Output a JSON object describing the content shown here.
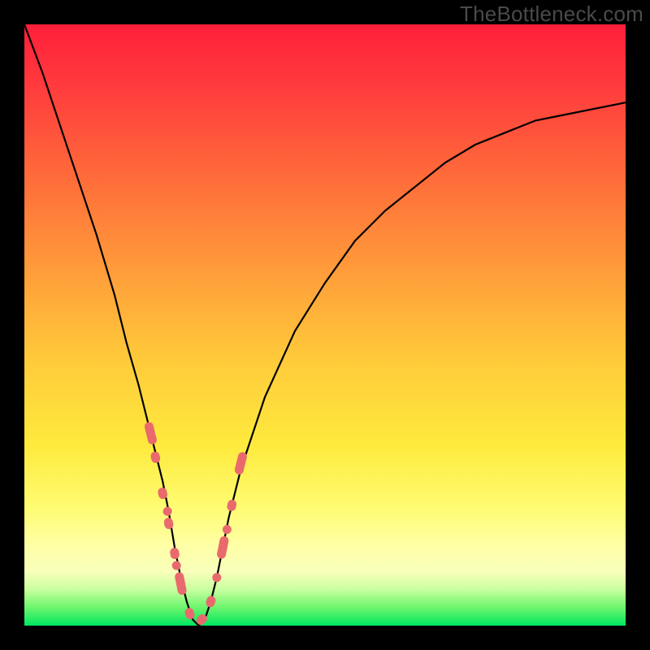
{
  "watermark": "TheBottleneck.com",
  "colors": {
    "background": "#000000",
    "gradient_top": "#ff1f3a",
    "gradient_bottom": "#00e862",
    "curve_stroke": "#000000",
    "marker_fill": "#e96a6d"
  },
  "chart_data": {
    "type": "line",
    "title": "",
    "xlabel": "",
    "ylabel": "",
    "xlim": [
      0,
      100
    ],
    "ylim": [
      0,
      100
    ],
    "grid": false,
    "legend": false,
    "series": [
      {
        "name": "bottleneck-curve",
        "x": [
          0,
          3,
          6,
          9,
          12,
          15,
          17,
          19,
          21,
          22,
          23,
          24,
          25,
          26,
          27,
          28,
          29,
          30,
          31,
          32,
          33,
          34,
          36,
          40,
          45,
          50,
          55,
          60,
          65,
          70,
          75,
          80,
          85,
          90,
          95,
          100
        ],
        "y": [
          100,
          92,
          83,
          74,
          65,
          55,
          47,
          40,
          32,
          28,
          24,
          19,
          13,
          8,
          4,
          1,
          0,
          1,
          4,
          8,
          13,
          18,
          26,
          38,
          49,
          57,
          64,
          69,
          73,
          77,
          80,
          82,
          84,
          85,
          86,
          87
        ]
      }
    ],
    "markers": {
      "name": "highlight-points",
      "style": "pill-and-dot",
      "color": "#e96a6d",
      "points": [
        {
          "x": 21.0,
          "y": 32
        },
        {
          "x": 21.8,
          "y": 28
        },
        {
          "x": 23.0,
          "y": 22
        },
        {
          "x": 24.0,
          "y": 17
        },
        {
          "x": 25.0,
          "y": 12
        },
        {
          "x": 26.0,
          "y": 7
        },
        {
          "x": 27.5,
          "y": 2
        },
        {
          "x": 29.5,
          "y": 1
        },
        {
          "x": 31.0,
          "y": 4
        },
        {
          "x": 33.0,
          "y": 13
        },
        {
          "x": 34.5,
          "y": 20
        },
        {
          "x": 36.0,
          "y": 27
        }
      ]
    },
    "annotations": []
  }
}
